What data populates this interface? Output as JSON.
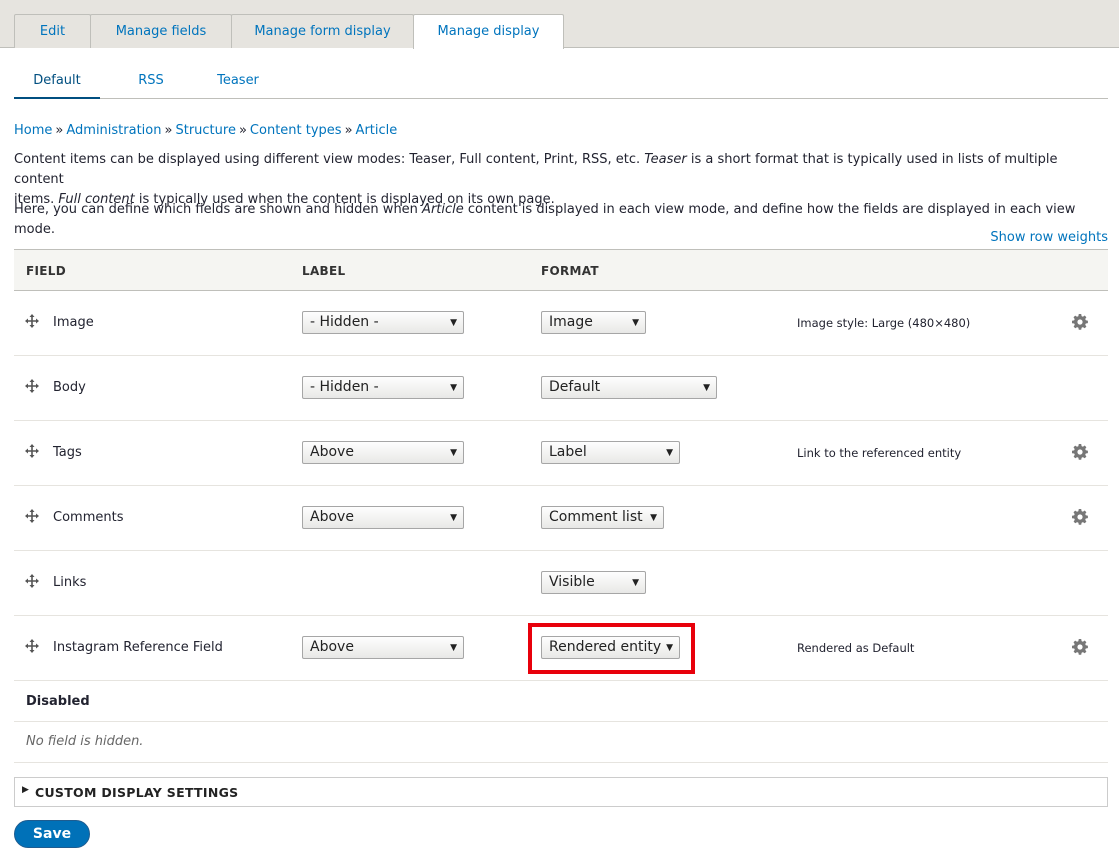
{
  "primary_tabs": [
    {
      "label": "Edit"
    },
    {
      "label": "Manage fields"
    },
    {
      "label": "Manage form display"
    },
    {
      "label": "Manage display",
      "active": true
    }
  ],
  "secondary_tabs": [
    {
      "label": "Default",
      "active": true
    },
    {
      "label": "RSS"
    },
    {
      "label": "Teaser"
    }
  ],
  "breadcrumb": [
    "Home",
    "Administration",
    "Structure",
    "Content types",
    "Article"
  ],
  "description": {
    "p1_a": "Content items can be displayed using different view modes: Teaser, Full content, Print, RSS, etc. ",
    "p1_b": "Teaser",
    "p1_c": " is a short format that is typically used in lists of multiple content",
    "p1_d": "items. ",
    "p1_e": "Full content",
    "p1_f": " is typically used when the content is displayed on its own page.",
    "p2_a": "Here, you can define which fields are shown and hidden when ",
    "p2_b": "Article",
    "p2_c": " content is displayed in each view mode, and define how the fields are displayed in each view mode."
  },
  "show_row_weights": "Show row weights",
  "table": {
    "headers": {
      "field": "FIELD",
      "label": "LABEL",
      "format": "FORMAT"
    },
    "rows": [
      {
        "field": "Image",
        "label": "- Hidden -",
        "format": "Image",
        "summary": "Image style: Large (480×480)",
        "gear": true
      },
      {
        "field": "Body",
        "label": "- Hidden -",
        "format": "Default",
        "summary": "",
        "gear": false
      },
      {
        "field": "Tags",
        "label": "Above",
        "format": "Label",
        "summary": "Link to the referenced entity",
        "gear": true
      },
      {
        "field": "Comments",
        "label": "Above",
        "format": "Comment list",
        "summary": "",
        "gear": true
      },
      {
        "field": "Links",
        "label": "",
        "format": "Visible",
        "summary": "",
        "gear": false
      },
      {
        "field": "Instagram Reference Field",
        "label": "Above",
        "format": "Rendered entity",
        "summary": "Rendered as Default",
        "gear": true,
        "highlighted": true
      }
    ],
    "disabled_label": "Disabled",
    "no_hidden": "No field is hidden."
  },
  "custom_display_settings": "CUSTOM DISPLAY SETTINGS",
  "save_label": "Save",
  "colors": {
    "link": "#0074bd",
    "highlight": "#e8000b",
    "button": "#0071b8"
  }
}
